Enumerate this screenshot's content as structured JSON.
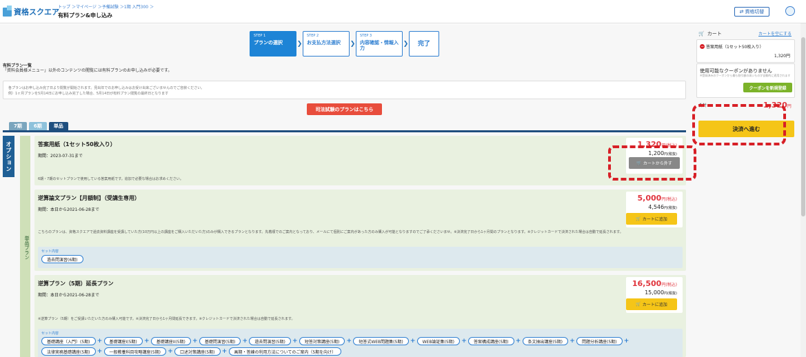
{
  "header": {
    "logo_text": "資格スクエア",
    "breadcrumb": [
      "トップ",
      "＞マイページ",
      "＞予備試験",
      "＞1期 入門300",
      "＞"
    ],
    "page_title": "有料プラン&申し込み",
    "switch_label": "資格切替"
  },
  "steps": [
    {
      "no": "STEP 1",
      "label": "プランの選択"
    },
    {
      "no": "STEP 2",
      "label": "お支払方法選択"
    },
    {
      "no": "STEP 3",
      "label": "内容確認・情報入力"
    },
    {
      "no": "",
      "label": "完了"
    }
  ],
  "section": {
    "title": "有料プラン一覧",
    "desc": "「資料会員様メニュー」以外のコンテンツの閲覧には有料プランのお申し込みが必要です。",
    "notice_line1": "各プランはお申し込み完了日より閲覧が開始されます。見出年でのお申し込みはお受け出来ございませんのでご容赦ください。",
    "notice_line2": "例）1ヶ月プランを5月14日にお申し込み完了した場合、5月14日が有料プラン閲覧の最終日となります"
  },
  "shiho_button": "司法試験のプランはこちら",
  "tabs": [
    "7期",
    "6期",
    "単品"
  ],
  "side": {
    "option": "オプション",
    "tanpin": "単品プラン"
  },
  "plans": [
    {
      "name": "答案用紙（1セット50枚入り）",
      "period": "期間：2023-07-31まで",
      "desc": "6期・7期のセットプランで使用している答案用紙です。追加で必要な場合はお求めください。",
      "price": "1,320",
      "price_suffix": "円(税込)",
      "sub_price": "1,200",
      "sub_suffix": "円(税抜)",
      "button": "カートから外す"
    },
    {
      "name": "逆算論文プラン【月額制】（受講生専用）",
      "period": "期間：本日から2021-06-28まで",
      "desc": "こちらのプランは、資格スクエアで過去資料講座を受講していた方(10万円以上の講座をご購入いただいた方)のみが購入できるプランとなります。先着順でのご案内となっており、メールにて個別にご案内があった方のみ購入が可能となりますのでご了承くださいませ。※決済完了日から1ヶ月間のプランとなります。※クレジットカードで決済された場合は自動で延長されます。",
      "price": "5,000",
      "price_suffix": "円(税込)",
      "sub_price": "4,546",
      "sub_suffix": "円(税抜)",
      "button": "カートに追加",
      "set_label": "セット内容",
      "set_items": [
        "過去問演習(6期)"
      ]
    },
    {
      "name": "逆算プラン（5期）延長プラン",
      "period": "期間：本日から2021-06-28まで",
      "desc": "※逆算プラン（5期）をご受講いただいた方のみ購入可能です。※決済完了日から1ヶ月間延長できます。※クレジットカードで決済された場合は自動で延長されます。",
      "price": "16,500",
      "price_suffix": "円(税込)",
      "sub_price": "15,000",
      "sub_suffix": "円(税抜)",
      "button": "カートに追加",
      "set_label": "セット内容",
      "set_items": [
        "基礎講座（入門）(5期)",
        "基礎講座I(5期)",
        "基礎講座II(5期)",
        "基礎問演習(5期)",
        "過去問演習(5期)",
        "短答対策講座(5期)",
        "短答式WEB問題集(5期)",
        "WEB論証集(5期)",
        "答案構成講座(5期)",
        "条文抽出講座(5期)",
        "問題分析講座(5期)",
        "法律実務基礎講座(5期)",
        "一般教養科目攻略講座(5期)",
        "口述対策講座(5期)",
        "画期・答練の利用方法についてのご案内（5期を向け）"
      ]
    }
  ],
  "cart": {
    "title": "カート",
    "clear": "カートを空にする",
    "item_name": "答案用紙（1セット50枚入り）",
    "item_price": "1,320円",
    "coupon_title": "使用可能なクーポンがありません",
    "coupon_note": "※登録済みのクーポンから最も割引額の高いものが自動的に適用されます",
    "coupon_button": "クーポンを新規登録",
    "total_label": "合計",
    "total_price": "1,320",
    "total_suffix": "円",
    "pay_button": "決済へ進む"
  }
}
